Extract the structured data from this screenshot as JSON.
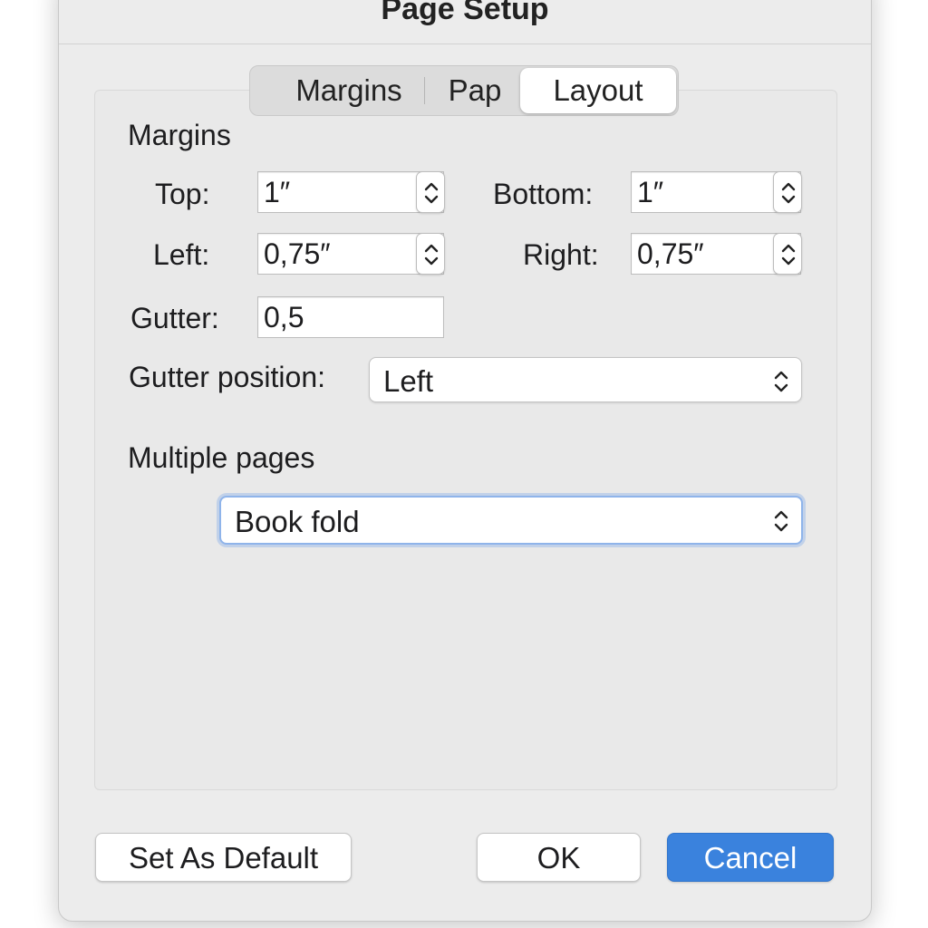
{
  "dialog": {
    "title": "Page Setup"
  },
  "tabs": [
    {
      "label": "Margins",
      "selected": false
    },
    {
      "label": "Pap",
      "selected": false
    },
    {
      "label": "Layout",
      "selected": true
    }
  ],
  "margins_section": {
    "heading": "Margins",
    "top": {
      "label": "Top:",
      "value": "1″"
    },
    "bottom": {
      "label": "Bottom:",
      "value": "1″"
    },
    "left": {
      "label": "Left:",
      "value": "0,75″"
    },
    "right": {
      "label": "Right:",
      "value": "0,75″"
    },
    "gutter": {
      "label": "Gutter:",
      "value": "0,5"
    },
    "gutter_position": {
      "label": "Gutter position:",
      "value": "Left"
    }
  },
  "multiple_pages": {
    "heading": "Multiple pages",
    "value": "Book fold"
  },
  "buttons": {
    "set_default": "Set As Default",
    "ok": "OK",
    "cancel": "Cancel"
  },
  "colors": {
    "accent": "#3a82dd",
    "focus_ring": "#8fb4ea"
  },
  "icons": {
    "stepper": "up-down-chevron-icon",
    "popup": "up-down-chevron-icon"
  }
}
